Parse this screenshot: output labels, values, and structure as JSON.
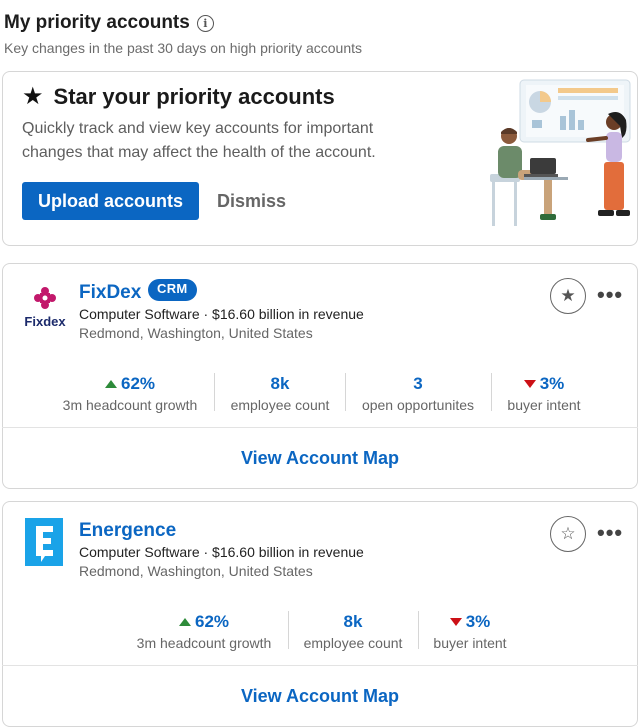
{
  "header": {
    "title": "My priority accounts",
    "subtitle": "Key changes in the past 30 days on high priority accounts"
  },
  "promo": {
    "title": "Star your priority accounts",
    "description": "Quickly track and view key accounts for important changes that may affect the health of the account.",
    "upload_label": "Upload accounts",
    "dismiss_label": "Dismiss"
  },
  "accounts": [
    {
      "logo_text": "Fixdex",
      "name": "FixDex",
      "badge": "CRM",
      "meta": "Computer Software · $16.60 billion in revenue",
      "location": "Redmond, Washington, United States",
      "starred": true,
      "stats": [
        {
          "value": "62%",
          "label": "3m headcount growth",
          "trend": "up"
        },
        {
          "value": "8k",
          "label": "employee count",
          "trend": "none"
        },
        {
          "value": "3",
          "label": "open opportunites",
          "trend": "none"
        },
        {
          "value": "3%",
          "label": "buyer intent",
          "trend": "down"
        }
      ],
      "view_map_label": "View Account Map"
    },
    {
      "name": "Energence",
      "meta": "Computer Software · $16.60 billion in revenue",
      "location": "Redmond, Washington, United States",
      "starred": false,
      "stats": [
        {
          "value": "62%",
          "label": "3m headcount growth",
          "trend": "up"
        },
        {
          "value": "8k",
          "label": "employee count",
          "trend": "none"
        },
        {
          "value": "3%",
          "label": "buyer intent",
          "trend": "down"
        }
      ],
      "view_map_label": "View Account Map"
    }
  ],
  "colors": {
    "accent": "#0b66c2",
    "trend_up": "#2e8b3a",
    "trend_down": "#cc1016"
  }
}
